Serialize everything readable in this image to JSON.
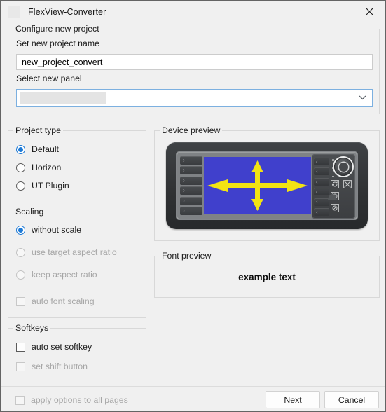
{
  "window": {
    "title": "FlexView-Converter",
    "app_icon": "app-icon-placeholder",
    "close_icon": "close-icon"
  },
  "configure_group": {
    "title": "Configure new project",
    "project_name_label": "Set new project name",
    "project_name_value": "new_project_convert",
    "project_name_placeholder": "",
    "select_panel_label": "Select new panel",
    "panel_combo_value": "",
    "panel_combo_arrow_icon": "chevron-down-icon"
  },
  "project_type": {
    "title": "Project type",
    "options": [
      {
        "label": "Default",
        "checked": true,
        "disabled": false
      },
      {
        "label": "Horizon",
        "checked": false,
        "disabled": false
      },
      {
        "label": "UT Plugin",
        "checked": false,
        "disabled": false
      }
    ]
  },
  "scaling": {
    "title": "Scaling",
    "options": [
      {
        "label": "without scale",
        "checked": true,
        "disabled": false
      },
      {
        "label": "use target aspect ratio",
        "checked": false,
        "disabled": true
      },
      {
        "label": "keep aspect ratio",
        "checked": false,
        "disabled": true
      }
    ],
    "auto_font_scaling": {
      "label": "auto font scaling",
      "checked": false,
      "disabled": true
    }
  },
  "softkeys": {
    "title": "Softkeys",
    "options": [
      {
        "label": "auto set softkey",
        "checked": false,
        "disabled": false
      },
      {
        "label": "set shift button",
        "checked": false,
        "disabled": true
      }
    ]
  },
  "apply_all": {
    "label": "apply options to all pages",
    "checked": false,
    "disabled": true
  },
  "device_preview": {
    "title": "Device preview",
    "screen_color": "#4040cc",
    "arrow_color": "#f2e313",
    "body_color": "#34363a",
    "left_softkeys": [
      "›",
      "›",
      "›",
      "›",
      "›",
      "›"
    ],
    "right_softkeys": [
      "‹",
      "‹",
      "‹",
      "‹",
      "‹",
      "‹"
    ],
    "indicator_dots": 4,
    "knob_icon": "rotary-knob-icon",
    "function_icons": [
      "refresh-cw-icon",
      "cross-box-icon",
      "refresh-ccw-icon",
      "cancel-box-icon"
    ]
  },
  "font_preview": {
    "title": "Font preview",
    "sample_text": "example text"
  },
  "footer": {
    "next_label": "Next",
    "cancel_label": "Cancel"
  }
}
